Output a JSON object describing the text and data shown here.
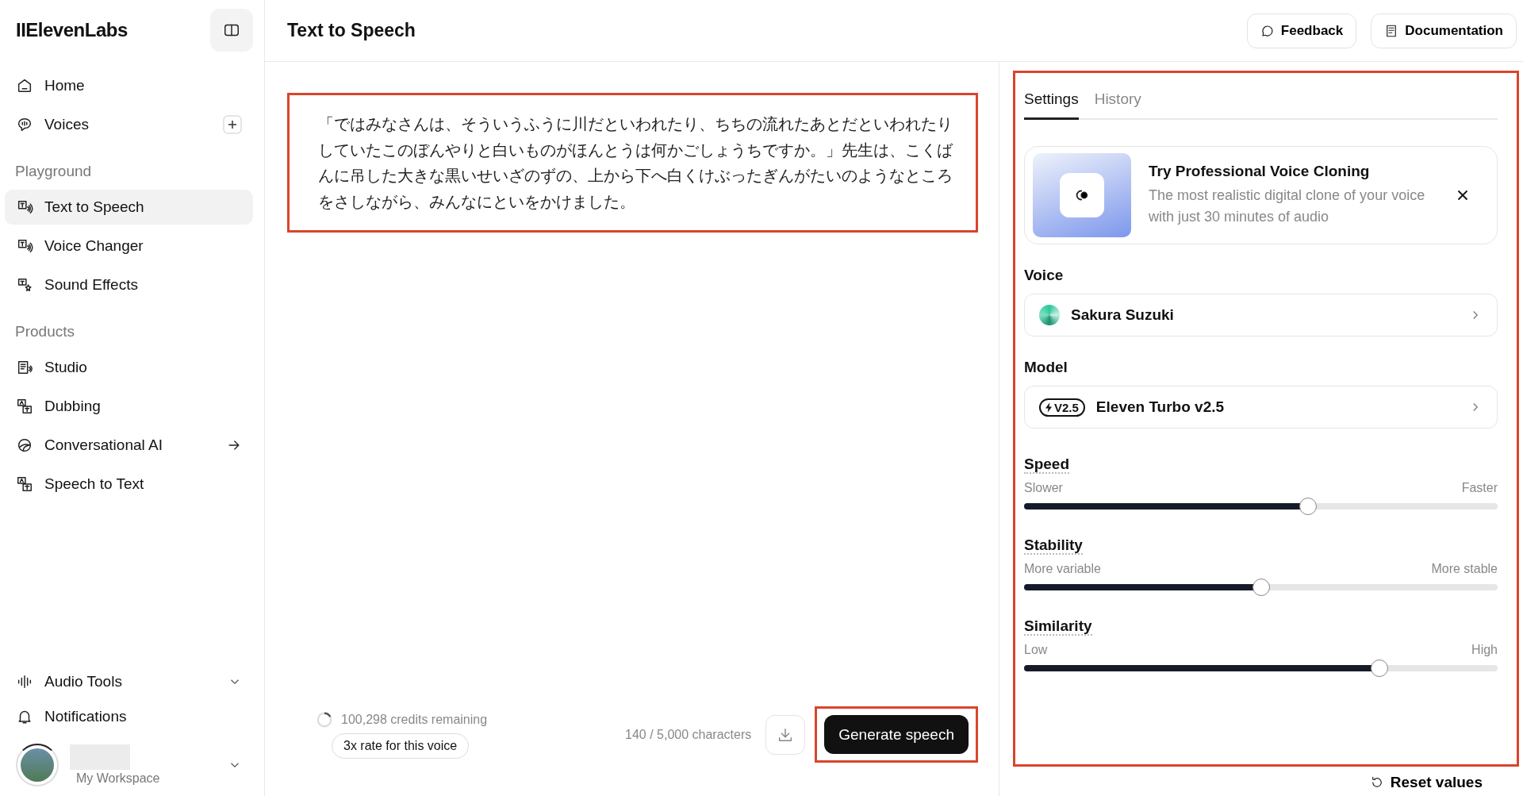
{
  "sidebar": {
    "logo": "IIElevenLabs",
    "top_items": [
      {
        "label": "Home",
        "kind": "home",
        "selected": false
      },
      {
        "label": "Voices",
        "kind": "voices",
        "selected": false
      }
    ],
    "sections": [
      {
        "title": "Playground",
        "items": [
          {
            "label": "Text to Speech",
            "kind": "tts",
            "selected": true
          },
          {
            "label": "Voice Changer",
            "kind": "vc",
            "selected": false
          },
          {
            "label": "Sound Effects",
            "kind": "sfx",
            "selected": false
          }
        ]
      },
      {
        "title": "Products",
        "items": [
          {
            "label": "Studio",
            "kind": "studio",
            "selected": false
          },
          {
            "label": "Dubbing",
            "kind": "dub",
            "selected": false
          },
          {
            "label": "Conversational AI",
            "kind": "conv",
            "selected": false
          },
          {
            "label": "Speech to Text",
            "kind": "stt",
            "selected": false
          }
        ]
      }
    ],
    "bottom_items": [
      {
        "label": "Audio Tools",
        "kind": "wave",
        "expanded": false
      },
      {
        "label": "Notifications",
        "kind": "bell"
      }
    ],
    "workspace": {
      "label": "My Workspace"
    }
  },
  "header": {
    "title": "Text to Speech",
    "buttons": [
      {
        "label": "Feedback",
        "kind": "chat"
      },
      {
        "label": "Documentation",
        "kind": "doc"
      }
    ]
  },
  "editor": {
    "text": "「ではみなさんは、そういうふうに川だといわれたり、ちちの流れたあとだといわれたりしていたこのぼんやりと白いものがほんとうは何かごしょうちですか。」先生は、こくばんに吊した大きな黒いせいざのずの、上から下へ白くけぶったぎんがたいのようなところをさしながら、みんなにといをかけました。",
    "credits": "100,298 credits remaining",
    "rate_badge": "3x rate for this voice",
    "char_count": "140 / 5,000 characters",
    "generate_button": "Generate speech"
  },
  "settings": {
    "tabs": [
      {
        "label": "Settings",
        "selected": true
      },
      {
        "label": "History",
        "selected": false
      }
    ],
    "promo": {
      "title": "Try Professional Voice Cloning",
      "text": "The most realistic digital clone of your voice with just 30 minutes of audio"
    },
    "voice": {
      "label": "Voice",
      "value": "Sakura Suzuki"
    },
    "model": {
      "label": "Model",
      "badge": "V2.5",
      "value": "Eleven Turbo v2.5"
    },
    "sliders": [
      {
        "name": "Speed",
        "low": "Slower",
        "high": "Faster",
        "level": 0.6
      },
      {
        "name": "Stability",
        "low": "More variable",
        "high": "More stable",
        "level": 0.5
      },
      {
        "name": "Similarity",
        "low": "Low",
        "high": "High",
        "level": 0.75
      }
    ],
    "reset": "Reset values"
  }
}
